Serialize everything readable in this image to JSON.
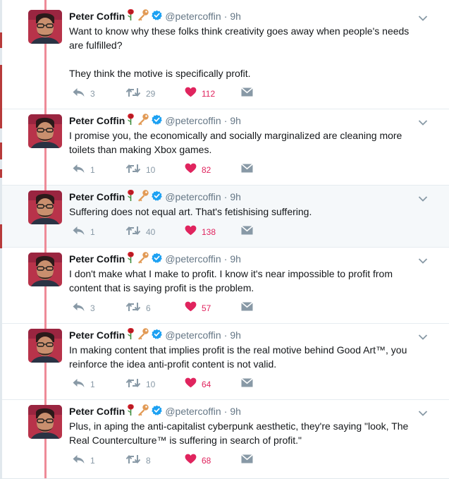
{
  "tweets": [
    {
      "name": "Peter Coffin",
      "handle": "@petercoffin",
      "dot": "·",
      "time": "9h",
      "lines": [
        "Want to know why these folks think creativity goes away when people's needs are fulfilled?",
        "",
        "They think the motive is specifically profit."
      ],
      "replies": "3",
      "retweets": "29",
      "likes": "112"
    },
    {
      "name": "Peter Coffin",
      "handle": "@petercoffin",
      "dot": "·",
      "time": "9h",
      "lines": [
        "I promise you, the economically and socially marginalized are cleaning more toilets than making Xbox games."
      ],
      "replies": "1",
      "retweets": "10",
      "likes": "82"
    },
    {
      "name": "Peter Coffin",
      "handle": "@petercoffin",
      "dot": "·",
      "time": "9h",
      "lines": [
        "Suffering does not equal art. That's fetishising suffering."
      ],
      "replies": "1",
      "retweets": "40",
      "likes": "138"
    },
    {
      "name": "Peter Coffin",
      "handle": "@petercoffin",
      "dot": "·",
      "time": "9h",
      "lines": [
        "I don't make what I make to profit. I know it's near impossible to profit from content that is saying profit is the problem."
      ],
      "replies": "3",
      "retweets": "6",
      "likes": "57"
    },
    {
      "name": "Peter Coffin",
      "handle": "@petercoffin",
      "dot": "·",
      "time": "9h",
      "lines": [
        "In making content that implies profit is the real motive behind Good Art™, you reinforce the idea anti-profit content is not valid."
      ],
      "replies": "1",
      "retweets": "10",
      "likes": "64"
    },
    {
      "name": "Peter Coffin",
      "handle": "@petercoffin",
      "dot": "·",
      "time": "9h",
      "lines": [
        "Plus, in aping the anti-capitalist cyberpunk aesthetic, they're saying \"look, The Real Counterculture™ is suffering in search of profit.\""
      ],
      "replies": "1",
      "retweets": "8",
      "likes": "68"
    }
  ],
  "icons": {
    "name_emoji_1": "rose-icon",
    "name_emoji_2": "key-icon",
    "verified": "verified-badge-icon",
    "caret": "chevron-down-icon",
    "reply": "reply-icon",
    "retweet": "retweet-icon",
    "like": "heart-icon",
    "dm": "direct-message-icon"
  },
  "colors": {
    "text": "#14171a",
    "muted": "#657786",
    "action_gray": "#8899a6",
    "like_red": "#e0245e",
    "verified_blue": "#1da1f2",
    "thread_line": "#ee8b98",
    "highlight_bg": "#f5f8fa"
  }
}
